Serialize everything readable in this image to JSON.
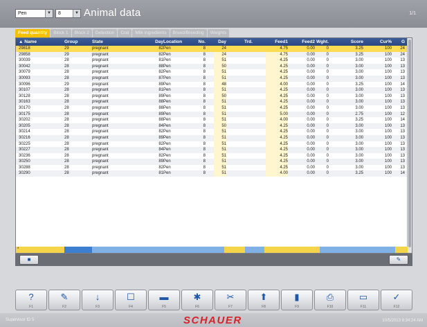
{
  "header": {
    "filter1": "Pen",
    "filter2": "8",
    "title": "Animal data",
    "page_counter": "1/1"
  },
  "tabs": [
    {
      "label": "Feed quantity",
      "active": true
    },
    {
      "label": "Block 1"
    },
    {
      "label": "Block 2"
    },
    {
      "label": "Detection"
    },
    {
      "label": "Cod"
    },
    {
      "label": "Milk ingredients"
    },
    {
      "label": "Breed/Breeding"
    },
    {
      "label": "Weights"
    }
  ],
  "columns": [
    "Name",
    "Group",
    "State",
    "Day",
    "Location",
    "No.",
    "Day",
    "Trd.",
    "Feed1",
    "Feed2",
    "Wght.",
    "Score",
    "Cur%",
    "G"
  ],
  "rows": [
    [
      "29818",
      "29",
      "pregnant",
      "82",
      "Pen",
      "8",
      "24",
      "",
      "4.75",
      "0.00",
      "0",
      "3.25",
      "100",
      "24"
    ],
    [
      "29858",
      "29",
      "pregnant",
      "82",
      "Pen",
      "8",
      "24",
      "",
      "4.75",
      "0.00",
      "0",
      "3.25",
      "100",
      "24"
    ],
    [
      "30039",
      "28",
      "pregnant",
      "81",
      "Pen",
      "8",
      "51",
      "",
      "4.25",
      "0.00",
      "0",
      "3.00",
      "100",
      "13"
    ],
    [
      "30042",
      "28",
      "pregnant",
      "88",
      "Pen",
      "8",
      "50",
      "",
      "4.25",
      "0.00",
      "0",
      "3.00",
      "100",
      "13"
    ],
    [
      "30079",
      "28",
      "pregnant",
      "82",
      "Pen",
      "8",
      "51",
      "",
      "4.25",
      "0.00",
      "0",
      "3.00",
      "100",
      "13"
    ],
    [
      "30093",
      "28",
      "pregnant",
      "87",
      "Pen",
      "8",
      "51",
      "",
      "4.25",
      "0.00",
      "0",
      "3.00",
      "100",
      "13"
    ],
    [
      "30096",
      "29",
      "pregnant",
      "89",
      "Pen",
      "8",
      "48",
      "",
      "4.00",
      "0.00",
      "0",
      "3.25",
      "100",
      "14"
    ],
    [
      "30107",
      "28",
      "pregnant",
      "81",
      "Pen",
      "8",
      "51",
      "",
      "4.25",
      "0.00",
      "0",
      "3.00",
      "100",
      "13"
    ],
    [
      "30128",
      "28",
      "pregnant",
      "89",
      "Pen",
      "8",
      "50",
      "",
      "4.25",
      "0.00",
      "0",
      "3.00",
      "100",
      "13"
    ],
    [
      "30163",
      "28",
      "pregnant",
      "88",
      "Pen",
      "8",
      "51",
      "",
      "4.25",
      "0.00",
      "0",
      "3.00",
      "100",
      "13"
    ],
    [
      "30170",
      "28",
      "pregnant",
      "88",
      "Pen",
      "8",
      "51",
      "",
      "4.25",
      "0.00",
      "0",
      "3.00",
      "100",
      "13"
    ],
    [
      "30175",
      "28",
      "pregnant",
      "89",
      "Pen",
      "8",
      "51",
      "",
      "5.00",
      "0.00",
      "0",
      "2.75",
      "100",
      "12"
    ],
    [
      "30202",
      "28",
      "pregnant",
      "88",
      "Pen",
      "8",
      "51",
      "",
      "4.00",
      "0.00",
      "0",
      "3.25",
      "100",
      "14"
    ],
    [
      "30205",
      "28",
      "pregnant",
      "84",
      "Pen",
      "8",
      "50",
      "",
      "4.25",
      "0.00",
      "0",
      "3.00",
      "100",
      "13"
    ],
    [
      "30214",
      "28",
      "pregnant",
      "82",
      "Pen",
      "8",
      "51",
      "",
      "4.25",
      "0.00",
      "0",
      "3.00",
      "100",
      "13"
    ],
    [
      "30216",
      "28",
      "pregnant",
      "89",
      "Pen",
      "8",
      "51",
      "",
      "4.25",
      "0.00",
      "0",
      "3.00",
      "100",
      "13"
    ],
    [
      "30225",
      "28",
      "pregnant",
      "82",
      "Pen",
      "8",
      "51",
      "",
      "4.25",
      "0.00",
      "0",
      "3.00",
      "100",
      "13"
    ],
    [
      "30227",
      "28",
      "pregnant",
      "84",
      "Pen",
      "8",
      "51",
      "",
      "4.25",
      "0.00",
      "0",
      "3.00",
      "100",
      "13"
    ],
    [
      "30236",
      "28",
      "pregnant",
      "82",
      "Pen",
      "8",
      "51",
      "",
      "4.25",
      "0.00",
      "0",
      "3.00",
      "100",
      "13"
    ],
    [
      "30250",
      "28",
      "pregnant",
      "89",
      "Pen",
      "8",
      "51",
      "",
      "4.25",
      "0.00",
      "0",
      "3.00",
      "100",
      "13"
    ],
    [
      "30288",
      "28",
      "pregnant",
      "82",
      "Pen",
      "8",
      "51",
      "",
      "4.25",
      "0.00",
      "0",
      "3.00",
      "100",
      "13"
    ],
    [
      "30290",
      "28",
      "pregnant",
      "81",
      "Pen",
      "8",
      "51",
      "",
      "4.00",
      "0.00",
      "0",
      "3.25",
      "100",
      "14"
    ]
  ],
  "selected_row": 0,
  "filter_row_marker": "*",
  "function_keys": [
    {
      "icon": "?",
      "icon_name": "help-icon",
      "label": "F1"
    },
    {
      "icon": "✎",
      "icon_name": "edit-icon",
      "label": "F2"
    },
    {
      "icon": "↓",
      "icon_name": "sort-icon",
      "label": "F3"
    },
    {
      "icon": "☐",
      "icon_name": "page-icon",
      "label": "F4"
    },
    {
      "icon": "▬",
      "icon_name": "card-icon",
      "label": "F5"
    },
    {
      "icon": "✱",
      "icon_name": "asterisk-icon",
      "label": "F6"
    },
    {
      "icon": "✂",
      "icon_name": "cut-icon",
      "label": "F7"
    },
    {
      "icon": "⬆",
      "icon_name": "upload-icon",
      "label": "F8"
    },
    {
      "icon": "▮",
      "icon_name": "device-icon",
      "label": "F9"
    },
    {
      "icon": "⎙",
      "icon_name": "print-icon",
      "label": "F10"
    },
    {
      "icon": "▭",
      "icon_name": "keyboard-icon",
      "label": "F11"
    },
    {
      "icon": "✓",
      "icon_name": "check-icon",
      "label": "F12"
    }
  ],
  "footer": {
    "user": "Supervisor ID 5",
    "logo": "SCHAUER",
    "clock": "10/5/2013 8:34:24 AM"
  },
  "colors": {
    "accent_yellow": "#f4c000",
    "header_blue": "#2b4780",
    "logo_red": "#d8222a"
  }
}
